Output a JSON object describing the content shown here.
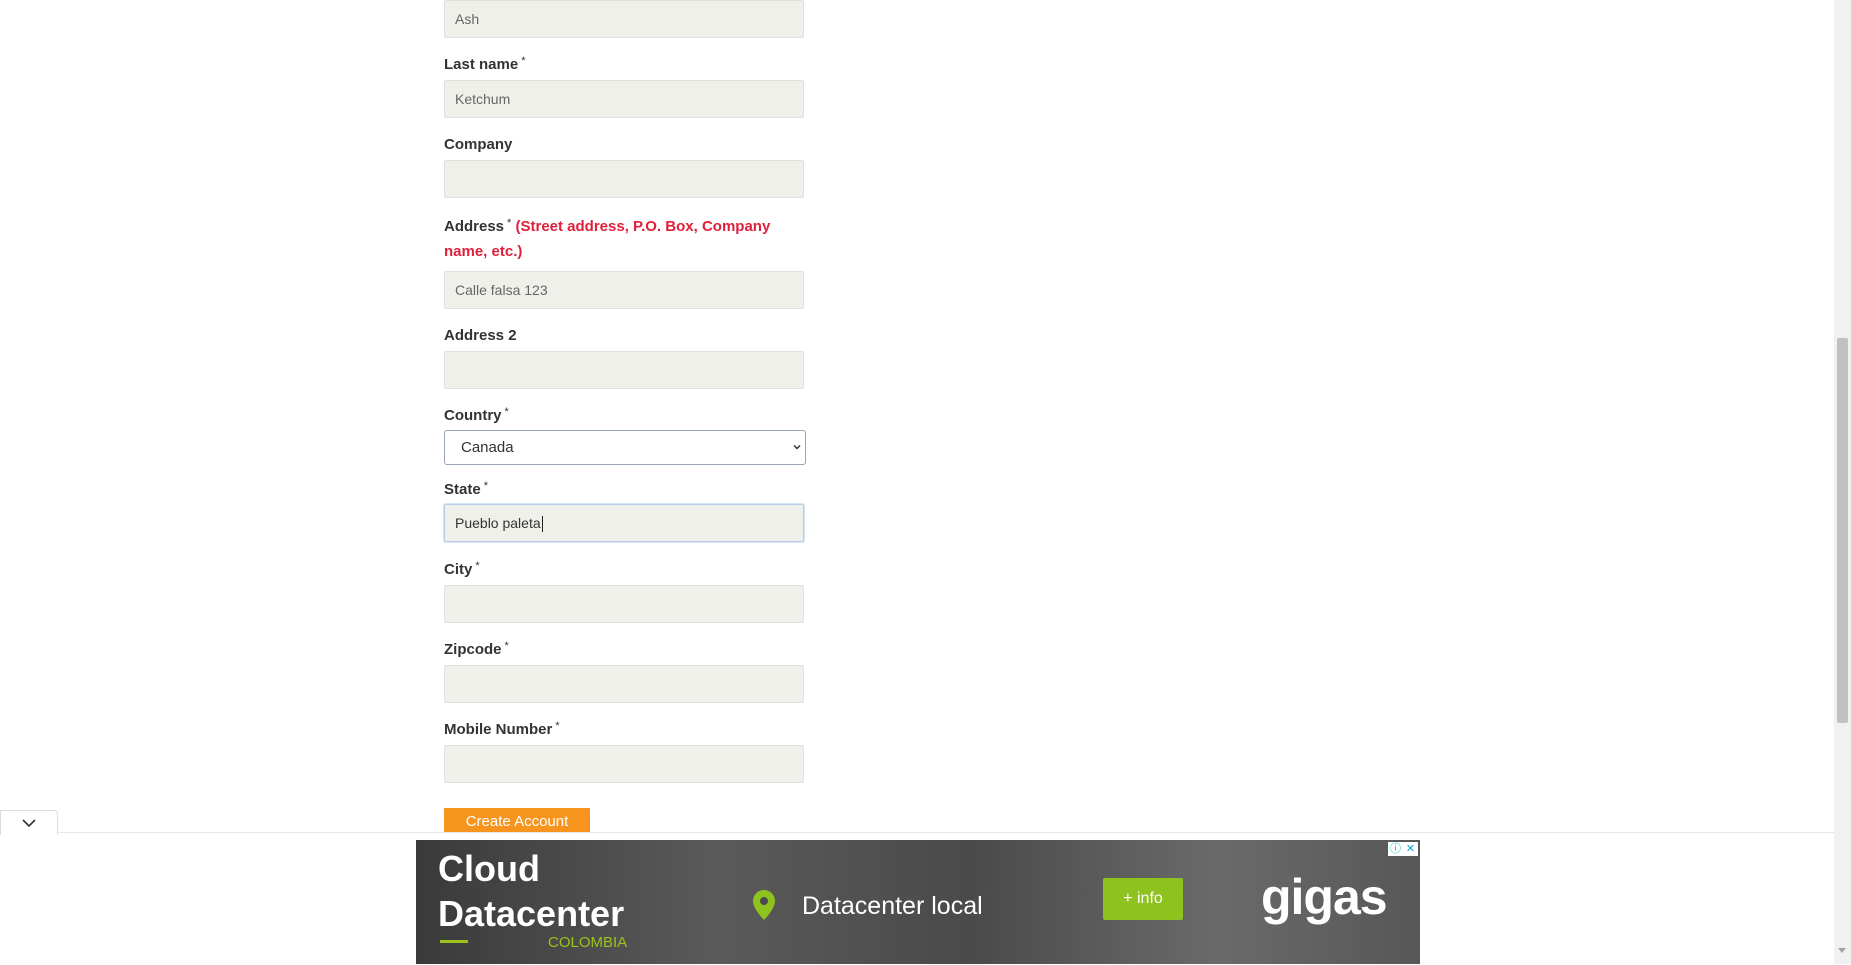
{
  "form": {
    "first_name": {
      "value": "Ash"
    },
    "last_name": {
      "label": "Last name",
      "required": "*",
      "value": "Ketchum"
    },
    "company": {
      "label": "Company",
      "value": ""
    },
    "address": {
      "label": "Address",
      "required": "*",
      "hint": "(Street address, P.O. Box, Company name, etc.)",
      "value": "Calle falsa 123"
    },
    "address2": {
      "label": "Address 2",
      "value": ""
    },
    "country": {
      "label": "Country",
      "required": "*",
      "value": "Canada"
    },
    "state": {
      "label": "State",
      "required": "*",
      "value": "Pueblo paleta"
    },
    "city": {
      "label": "City",
      "required": "*",
      "value": ""
    },
    "zipcode": {
      "label": "Zipcode",
      "required": "*",
      "value": ""
    },
    "mobile": {
      "label": "Mobile Number",
      "required": "*",
      "value": ""
    },
    "submit_label": "Create Account"
  },
  "ad": {
    "title_line1": "Cloud",
    "title_line2": "Datacenter",
    "subtitle": "COLOMBIA",
    "tagline": "Datacenter local",
    "cta": "+ info",
    "logo": "gigas",
    "info_icon": "ⓘ",
    "close_icon": "✕",
    "accent_color": "#8dc21f"
  },
  "colors": {
    "button": "#f7941d",
    "hint": "#e0203a",
    "input_bg": "#f0f0eb"
  }
}
